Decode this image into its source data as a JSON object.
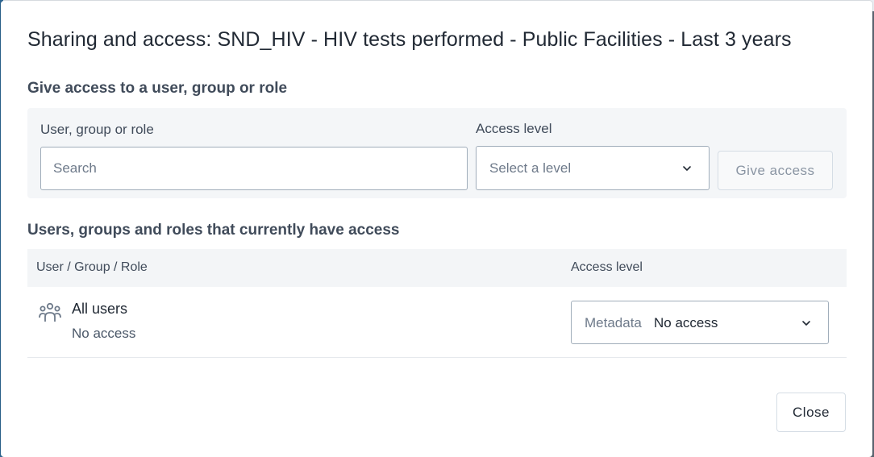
{
  "dialog": {
    "title": "Sharing and access: SND_HIV - HIV tests performed - Public Facilities - Last 3 years"
  },
  "give_access": {
    "heading": "Give access to a user, group or role",
    "user_label": "User, group or role",
    "search_placeholder": "Search",
    "search_value": "",
    "level_label": "Access level",
    "level_placeholder": "Select a level",
    "give_button": "Give access"
  },
  "current_access": {
    "heading": "Users, groups and roles that currently have access",
    "columns": [
      "User / Group / Role",
      "Access level"
    ],
    "rows": [
      {
        "icon": "user-group-icon",
        "name": "All users",
        "subtitle": "No access",
        "access_prefix": "Metadata",
        "access_value": "No access"
      }
    ]
  },
  "footer": {
    "close_button": "Close"
  },
  "colors": {
    "text_primary": "#212934",
    "text_secondary": "#404b5a",
    "panel_bg": "#f4f6f8",
    "border": "#a0adba"
  }
}
